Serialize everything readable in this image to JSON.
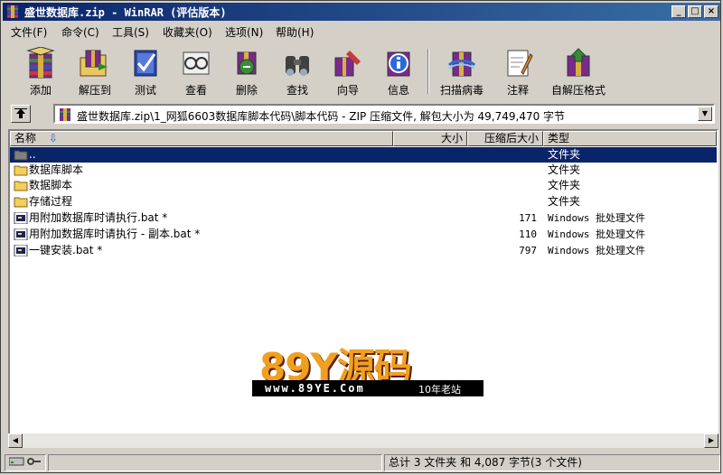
{
  "window": {
    "title": "盛世数据库.zip - WinRAR (评估版本)",
    "minimize": "_",
    "maximize": "□",
    "close": "×"
  },
  "menu": [
    "文件(F)",
    "命令(C)",
    "工具(S)",
    "收藏夹(O)",
    "选项(N)",
    "帮助(H)"
  ],
  "toolbar": [
    {
      "label": "添加",
      "icon": "add-archive-icon"
    },
    {
      "label": "解压到",
      "icon": "extract-to-icon"
    },
    {
      "label": "测试",
      "icon": "test-icon"
    },
    {
      "label": "查看",
      "icon": "view-icon"
    },
    {
      "label": "删除",
      "icon": "delete-icon"
    },
    {
      "label": "查找",
      "icon": "find-icon"
    },
    {
      "label": "向导",
      "icon": "wizard-icon"
    },
    {
      "label": "信息",
      "icon": "info-icon"
    },
    {
      "label": "扫描病毒",
      "icon": "virus-scan-icon"
    },
    {
      "label": "注释",
      "icon": "comment-icon"
    },
    {
      "label": "自解压格式",
      "icon": "sfx-icon"
    }
  ],
  "address": "盛世数据库.zip\\1_网狐6603数据库脚本代码\\脚本代码 - ZIP 压缩文件, 解包大小为 49,749,470 字节",
  "columns": {
    "name": "名称",
    "size": "大小",
    "packed": "压缩后大小",
    "type": "类型"
  },
  "files": [
    {
      "name": "..",
      "size": "",
      "type": "文件夹",
      "icon": "folder-up-icon",
      "selected": true
    },
    {
      "name": "数据库脚本",
      "size": "",
      "type": "文件夹",
      "icon": "folder-icon"
    },
    {
      "name": "数据脚本",
      "size": "",
      "type": "文件夹",
      "icon": "folder-icon"
    },
    {
      "name": "存储过程",
      "size": "",
      "type": "文件夹",
      "icon": "folder-icon"
    },
    {
      "name": "用附加数据库时请执行.bat *",
      "size": "171",
      "type": "Windows 批处理文件",
      "icon": "batch-file-icon"
    },
    {
      "name": "用附加数据库时请执行 - 副本.bat *",
      "size": "110",
      "type": "Windows 批处理文件",
      "icon": "batch-file-icon"
    },
    {
      "name": "一键安装.bat *",
      "size": "797",
      "type": "Windows 批处理文件",
      "icon": "batch-file-icon"
    }
  ],
  "watermark": {
    "logo": "89Y源码",
    "site": "www.89YE.Com",
    "slogan": "10年老站"
  },
  "status": "总计 3 文件夹 和 4,087 字节(3 个文件)"
}
